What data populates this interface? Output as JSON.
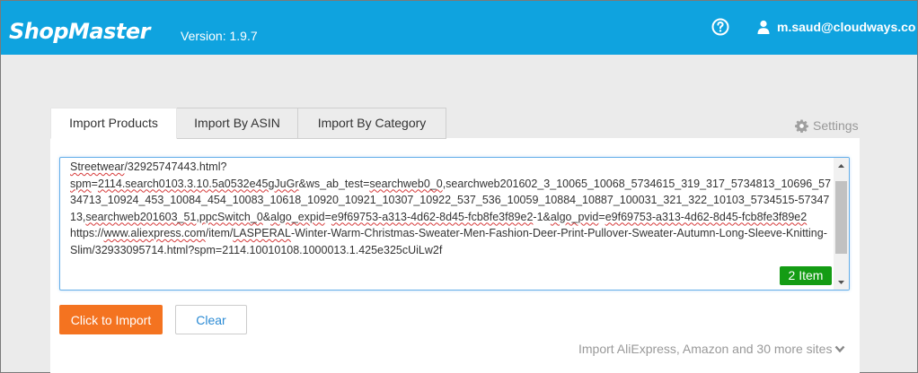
{
  "header": {
    "logo": "ShopMaster",
    "version": "Version:  1.9.7",
    "user_email": "m.saud@cloudways.com",
    "bg_color": "#0fa3df"
  },
  "tabs": [
    {
      "label": "Import Products",
      "active": true
    },
    {
      "label": "Import By ASIN",
      "active": false
    },
    {
      "label": "Import By Category",
      "active": false
    }
  ],
  "settings_label": "Settings",
  "textarea": {
    "segments": [
      {
        "t": "Streetwear",
        "sq": true
      },
      {
        "t": "/32925747443.html?\n"
      },
      {
        "t": "spm",
        "sq": true
      },
      {
        "t": "="
      },
      {
        "t": "2114.search0103.3.10.5a0532e45gJuGr",
        "sq": true
      },
      {
        "t": "&ws_ab_test="
      },
      {
        "t": "searchweb0_0",
        "sq": true
      },
      {
        "t": ","
      },
      {
        "t": "searchweb201602_3_10065_10068_5734615_319_317_5734813_10696_5734713_10924_453_10084_454_10083_10618_10920_10921_10307_10922_537_536_10059_10884_10887_100031_321_322_10103_5734515-5734713",
        "sq": false
      },
      {
        "t": ","
      },
      {
        "t": "searchweb201603_51",
        "sq": true
      },
      {
        "t": ","
      },
      {
        "t": "ppcSwitch_0",
        "sq": true
      },
      {
        "t": "&"
      },
      {
        "t": "algo_expid",
        "sq": true
      },
      {
        "t": "="
      },
      {
        "t": "e9f69753-a313-4d62-8d45-fcb8fe3f89e2",
        "sq": true
      },
      {
        "t": "-1&"
      },
      {
        "t": "algo_pvid",
        "sq": true
      },
      {
        "t": "="
      },
      {
        "t": "e9f69753-a313-4d62-8d45-fcb8fe3f89e2",
        "sq": true
      },
      {
        "t": "\nhttps://"
      },
      {
        "t": "www.aliexpress.com",
        "sq": true
      },
      {
        "t": "/item/"
      },
      {
        "t": "LASPERAL",
        "sq": true
      },
      {
        "t": "-Winter-Warm-Christmas-Sweater-Men-Fashion-Deer-Print-Pullover-Sweater-Autumn-Long-Sleeve-Knitting-Slim/32933095714.html?spm=2114.10010108.1000013.1.425e325cUiLw2f"
      }
    ]
  },
  "item_count": "2 Item",
  "buttons": {
    "import": "Click to Import",
    "clear": "Clear"
  },
  "footer_hint": "Import AliExpress, Amazon and 30 more sites",
  "colors": {
    "accent_orange": "#f47320",
    "badge_green": "#149c14",
    "link_blue": "#2a8ad4"
  }
}
